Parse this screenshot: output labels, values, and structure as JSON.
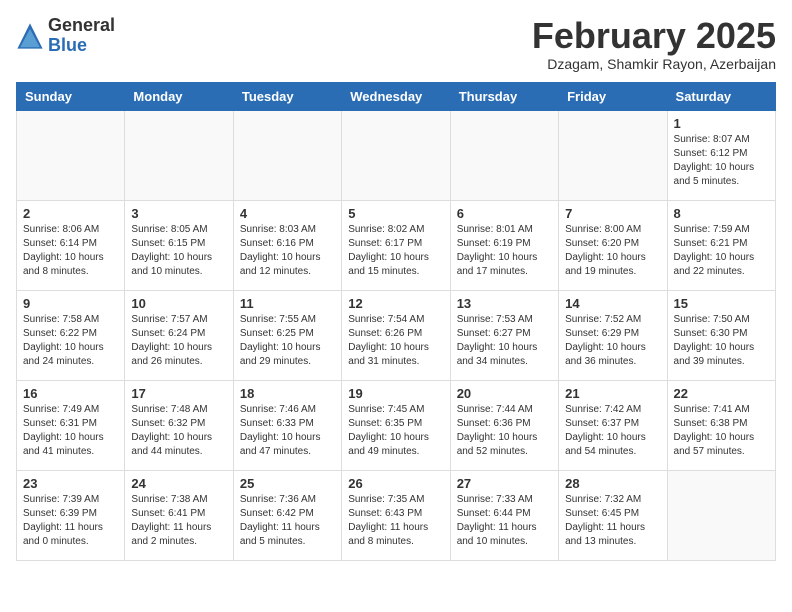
{
  "logo": {
    "general": "General",
    "blue": "Blue"
  },
  "title": "February 2025",
  "subtitle": "Dzagam, Shamkir Rayon, Azerbaijan",
  "days_of_week": [
    "Sunday",
    "Monday",
    "Tuesday",
    "Wednesday",
    "Thursday",
    "Friday",
    "Saturday"
  ],
  "weeks": [
    [
      {
        "day": "",
        "info": ""
      },
      {
        "day": "",
        "info": ""
      },
      {
        "day": "",
        "info": ""
      },
      {
        "day": "",
        "info": ""
      },
      {
        "day": "",
        "info": ""
      },
      {
        "day": "",
        "info": ""
      },
      {
        "day": "1",
        "info": "Sunrise: 8:07 AM\nSunset: 6:12 PM\nDaylight: 10 hours\nand 5 minutes."
      }
    ],
    [
      {
        "day": "2",
        "info": "Sunrise: 8:06 AM\nSunset: 6:14 PM\nDaylight: 10 hours\nand 8 minutes."
      },
      {
        "day": "3",
        "info": "Sunrise: 8:05 AM\nSunset: 6:15 PM\nDaylight: 10 hours\nand 10 minutes."
      },
      {
        "day": "4",
        "info": "Sunrise: 8:03 AM\nSunset: 6:16 PM\nDaylight: 10 hours\nand 12 minutes."
      },
      {
        "day": "5",
        "info": "Sunrise: 8:02 AM\nSunset: 6:17 PM\nDaylight: 10 hours\nand 15 minutes."
      },
      {
        "day": "6",
        "info": "Sunrise: 8:01 AM\nSunset: 6:19 PM\nDaylight: 10 hours\nand 17 minutes."
      },
      {
        "day": "7",
        "info": "Sunrise: 8:00 AM\nSunset: 6:20 PM\nDaylight: 10 hours\nand 19 minutes."
      },
      {
        "day": "8",
        "info": "Sunrise: 7:59 AM\nSunset: 6:21 PM\nDaylight: 10 hours\nand 22 minutes."
      }
    ],
    [
      {
        "day": "9",
        "info": "Sunrise: 7:58 AM\nSunset: 6:22 PM\nDaylight: 10 hours\nand 24 minutes."
      },
      {
        "day": "10",
        "info": "Sunrise: 7:57 AM\nSunset: 6:24 PM\nDaylight: 10 hours\nand 26 minutes."
      },
      {
        "day": "11",
        "info": "Sunrise: 7:55 AM\nSunset: 6:25 PM\nDaylight: 10 hours\nand 29 minutes."
      },
      {
        "day": "12",
        "info": "Sunrise: 7:54 AM\nSunset: 6:26 PM\nDaylight: 10 hours\nand 31 minutes."
      },
      {
        "day": "13",
        "info": "Sunrise: 7:53 AM\nSunset: 6:27 PM\nDaylight: 10 hours\nand 34 minutes."
      },
      {
        "day": "14",
        "info": "Sunrise: 7:52 AM\nSunset: 6:29 PM\nDaylight: 10 hours\nand 36 minutes."
      },
      {
        "day": "15",
        "info": "Sunrise: 7:50 AM\nSunset: 6:30 PM\nDaylight: 10 hours\nand 39 minutes."
      }
    ],
    [
      {
        "day": "16",
        "info": "Sunrise: 7:49 AM\nSunset: 6:31 PM\nDaylight: 10 hours\nand 41 minutes."
      },
      {
        "day": "17",
        "info": "Sunrise: 7:48 AM\nSunset: 6:32 PM\nDaylight: 10 hours\nand 44 minutes."
      },
      {
        "day": "18",
        "info": "Sunrise: 7:46 AM\nSunset: 6:33 PM\nDaylight: 10 hours\nand 47 minutes."
      },
      {
        "day": "19",
        "info": "Sunrise: 7:45 AM\nSunset: 6:35 PM\nDaylight: 10 hours\nand 49 minutes."
      },
      {
        "day": "20",
        "info": "Sunrise: 7:44 AM\nSunset: 6:36 PM\nDaylight: 10 hours\nand 52 minutes."
      },
      {
        "day": "21",
        "info": "Sunrise: 7:42 AM\nSunset: 6:37 PM\nDaylight: 10 hours\nand 54 minutes."
      },
      {
        "day": "22",
        "info": "Sunrise: 7:41 AM\nSunset: 6:38 PM\nDaylight: 10 hours\nand 57 minutes."
      }
    ],
    [
      {
        "day": "23",
        "info": "Sunrise: 7:39 AM\nSunset: 6:39 PM\nDaylight: 11 hours\nand 0 minutes."
      },
      {
        "day": "24",
        "info": "Sunrise: 7:38 AM\nSunset: 6:41 PM\nDaylight: 11 hours\nand 2 minutes."
      },
      {
        "day": "25",
        "info": "Sunrise: 7:36 AM\nSunset: 6:42 PM\nDaylight: 11 hours\nand 5 minutes."
      },
      {
        "day": "26",
        "info": "Sunrise: 7:35 AM\nSunset: 6:43 PM\nDaylight: 11 hours\nand 8 minutes."
      },
      {
        "day": "27",
        "info": "Sunrise: 7:33 AM\nSunset: 6:44 PM\nDaylight: 11 hours\nand 10 minutes."
      },
      {
        "day": "28",
        "info": "Sunrise: 7:32 AM\nSunset: 6:45 PM\nDaylight: 11 hours\nand 13 minutes."
      },
      {
        "day": "",
        "info": ""
      }
    ]
  ]
}
